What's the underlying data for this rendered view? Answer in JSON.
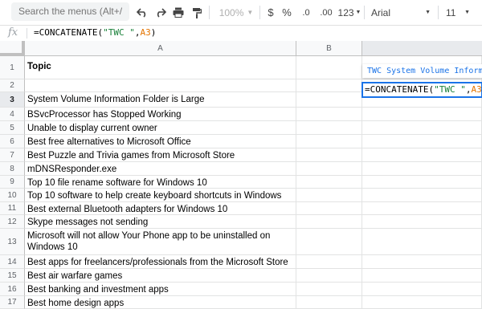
{
  "toolbar": {
    "search_placeholder": "Search the menus (Alt+/)",
    "zoom": "100%",
    "currency_symbol": "$",
    "percent_symbol": "%",
    "decimal_decrease": ".0",
    "decimal_increase": ".00",
    "number_format": "123",
    "font_name": "Arial",
    "font_size": "11"
  },
  "formula_bar": {
    "fx_label": "fx",
    "formula_prefix": "=CONCATENATE(",
    "formula_string": "\"TWC \"",
    "formula_comma": ",",
    "formula_ref": "A3",
    "formula_suffix": ")"
  },
  "columns": [
    "A",
    "B"
  ],
  "rows": [
    {
      "num": "1",
      "a": "Topic",
      "bold": true
    },
    {
      "num": "2",
      "a": ""
    },
    {
      "num": "3",
      "a": "System Volume Information Folder is Large"
    },
    {
      "num": "4",
      "a": "BSvcProcessor has Stopped Working"
    },
    {
      "num": "5",
      "a": "Unable to display current owner"
    },
    {
      "num": "6",
      "a": "Best free alternatives to Microsoft Office"
    },
    {
      "num": "7",
      "a": "Best Puzzle and Trivia games from Microsoft Store"
    },
    {
      "num": "8",
      "a": "mDNSResponder.exe"
    },
    {
      "num": "9",
      "a": "Top 10 file rename software for Windows 10"
    },
    {
      "num": "10",
      "a": "Top 10 software to help create keyboard shortcuts in Windows 10"
    },
    {
      "num": "11",
      "a": "Best external Bluetooth adapters for Windows 10"
    },
    {
      "num": "12",
      "a": "Skype messages not sending"
    },
    {
      "num": "13",
      "a": "Microsoft will not allow Your Phone app to be uninstalled on Windows 10"
    },
    {
      "num": "14",
      "a": "Best apps for freelancers/professionals from the Microsoft Store"
    },
    {
      "num": "15",
      "a": "Best air warfare games"
    },
    {
      "num": "16",
      "a": "Best banking and investment apps"
    },
    {
      "num": "17",
      "a": "Best home design apps"
    }
  ],
  "active_cell": {
    "formula_prefix": "=CONCATENATE(",
    "formula_string": "\"TWC \"",
    "formula_comma": ",",
    "formula_ref": "A3",
    "formula_suffix": ")"
  },
  "preview_hint": "TWC System Volume Information Folder is Large",
  "colors": {
    "accent": "#1a73e8",
    "string_literal": "#188038",
    "cell_reference": "#e37400"
  }
}
